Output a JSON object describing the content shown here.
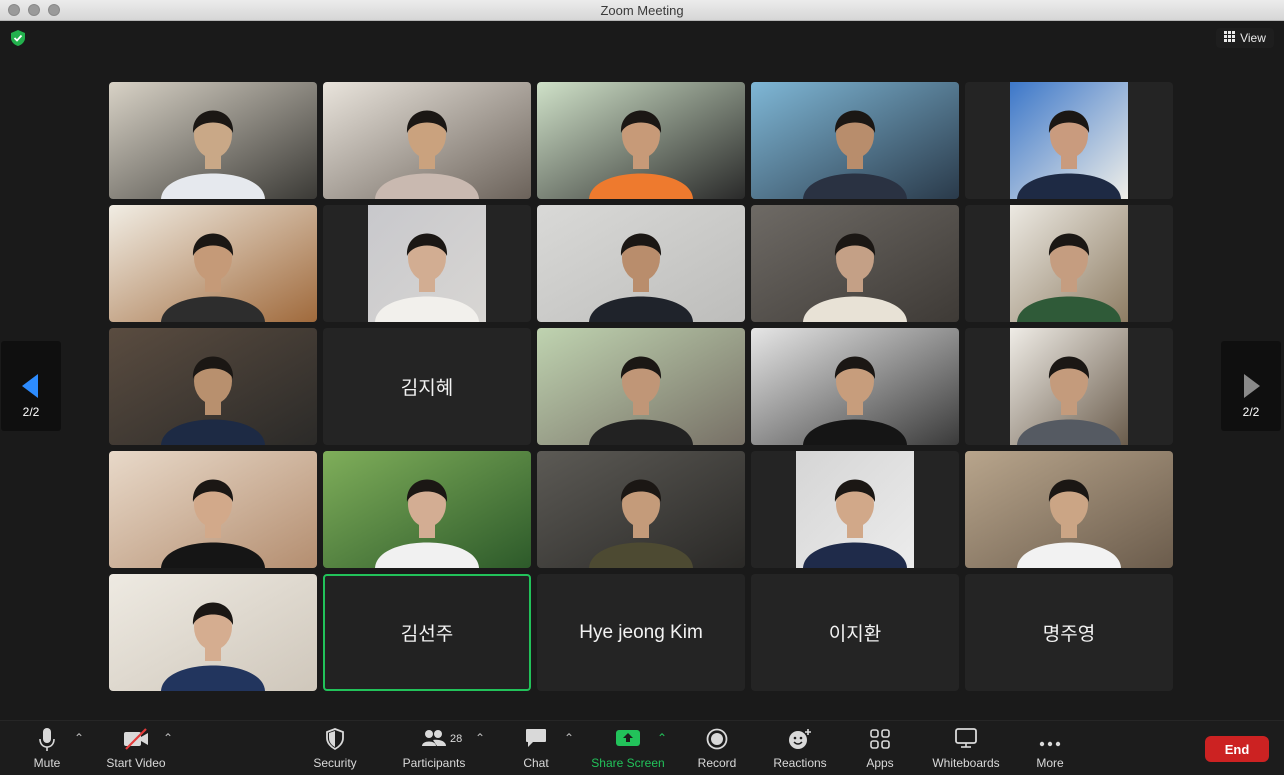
{
  "window": {
    "title": "Zoom Meeting"
  },
  "header": {
    "view_label": "View"
  },
  "pagination": {
    "page": "2/2"
  },
  "tiles": [
    {
      "type": "video",
      "bg": [
        "#d8d2c6",
        "#3b3a36"
      ],
      "skin": "#c9a887",
      "shirt": "#e6e9ee",
      "r": 0,
      "c": 0
    },
    {
      "type": "video",
      "bg": [
        "#e9e4dc",
        "#6b625a"
      ],
      "skin": "#caa27e",
      "shirt": "#c9b9b0",
      "r": 0,
      "c": 1
    },
    {
      "type": "video",
      "bg": [
        "#cfe1c8",
        "#2a2a2a"
      ],
      "skin": "#c79a78",
      "shirt": "#ee7a2e",
      "r": 0,
      "c": 2
    },
    {
      "type": "video",
      "bg": [
        "#7fb7d6",
        "#2a3a4a"
      ],
      "skin": "#b88d6c",
      "shirt": "#2a3242",
      "r": 0,
      "c": 3
    },
    {
      "type": "video",
      "bg": [
        "#3c77c9",
        "#f0efe9"
      ],
      "skin": "#c99b7e",
      "shirt": "#1e2a44",
      "r": 0,
      "c": 4,
      "narrow": true
    },
    {
      "type": "video",
      "bg": [
        "#f1ede4",
        "#a06a3c"
      ],
      "skin": "#c59a78",
      "shirt": "#2d2d2d",
      "r": 1,
      "c": 0
    },
    {
      "type": "video",
      "bg": [
        "#c8c8cc",
        "#d8d6d3"
      ],
      "skin": "#d2ad92",
      "shirt": "#f2f0ec",
      "r": 1,
      "c": 1,
      "narrow": true
    },
    {
      "type": "video",
      "bg": [
        "#d9d9d7",
        "#bdbdbb"
      ],
      "skin": "#b98d6c",
      "shirt": "#1f232b",
      "r": 1,
      "c": 2
    },
    {
      "type": "video",
      "bg": [
        "#6e6a65",
        "#3e3a36"
      ],
      "skin": "#c4a086",
      "shirt": "#e8e2d6",
      "r": 1,
      "c": 3
    },
    {
      "type": "video",
      "bg": [
        "#ece9e2",
        "#8e7d64"
      ],
      "skin": "#c59d80",
      "shirt": "#2f5a38",
      "r": 1,
      "c": 4,
      "narrow": true
    },
    {
      "type": "video",
      "bg": [
        "#5a4c40",
        "#2b2a28"
      ],
      "skin": "#b8906e",
      "shirt": "#1d2a44",
      "r": 2,
      "c": 0
    },
    {
      "type": "name",
      "label": "김지혜",
      "r": 2,
      "c": 1
    },
    {
      "type": "video",
      "bg": [
        "#bfd3b0",
        "#777066"
      ],
      "skin": "#c09677",
      "shirt": "#222222",
      "r": 2,
      "c": 2
    },
    {
      "type": "video",
      "bg": [
        "#e6e6e6",
        "#3a3a3a"
      ],
      "skin": "#c79d7c",
      "shirt": "#151515",
      "r": 2,
      "c": 3
    },
    {
      "type": "video",
      "bg": [
        "#efece6",
        "#6a5c4c"
      ],
      "skin": "#c49b7c",
      "shirt": "#555a62",
      "r": 2,
      "c": 4,
      "narrow": true
    },
    {
      "type": "video",
      "bg": [
        "#e8d9c9",
        "#b48e70"
      ],
      "skin": "#d2a98a",
      "shirt": "#151515",
      "r": 3,
      "c": 0
    },
    {
      "type": "video",
      "bg": [
        "#7fae5a",
        "#2d5a2a"
      ],
      "skin": "#d3ad93",
      "shirt": "#f1f1f1",
      "r": 3,
      "c": 1
    },
    {
      "type": "video",
      "bg": [
        "#5c5a55",
        "#2a2927"
      ],
      "skin": "#c49b7a",
      "shirt": "#4d4a32",
      "r": 3,
      "c": 2
    },
    {
      "type": "video",
      "bg": [
        "#d5d5d5",
        "#ececec"
      ],
      "skin": "#d1a889",
      "shirt": "#1f2b4a",
      "r": 3,
      "c": 3,
      "narrow": true
    },
    {
      "type": "video",
      "bg": [
        "#b8a58c",
        "#6b5c4c"
      ],
      "skin": "#cba585",
      "shirt": "#f2f2f2",
      "r": 3,
      "c": 4
    },
    {
      "type": "video",
      "bg": [
        "#eeeae2",
        "#cfc7bb"
      ],
      "skin": "#d5ad90",
      "shirt": "#22355e",
      "r": 4,
      "c": 0
    },
    {
      "type": "name",
      "label": "김선주",
      "r": 4,
      "c": 1,
      "active": true
    },
    {
      "type": "name",
      "label": "Hye jeong Kim",
      "r": 4,
      "c": 2
    },
    {
      "type": "name",
      "label": "이지환",
      "r": 4,
      "c": 3
    },
    {
      "type": "name",
      "label": "명주영",
      "r": 4,
      "c": 4
    }
  ],
  "toolbar": {
    "mute": "Mute",
    "start_video": "Start Video",
    "security": "Security",
    "participants": "Participants",
    "participants_count": "28",
    "chat": "Chat",
    "share_screen": "Share Screen",
    "record": "Record",
    "reactions": "Reactions",
    "apps": "Apps",
    "whiteboards": "Whiteboards",
    "more": "More",
    "end": "End"
  },
  "colors": {
    "share_green": "#22c25a",
    "end_red": "#cc2222",
    "active_border": "#22c25a"
  }
}
